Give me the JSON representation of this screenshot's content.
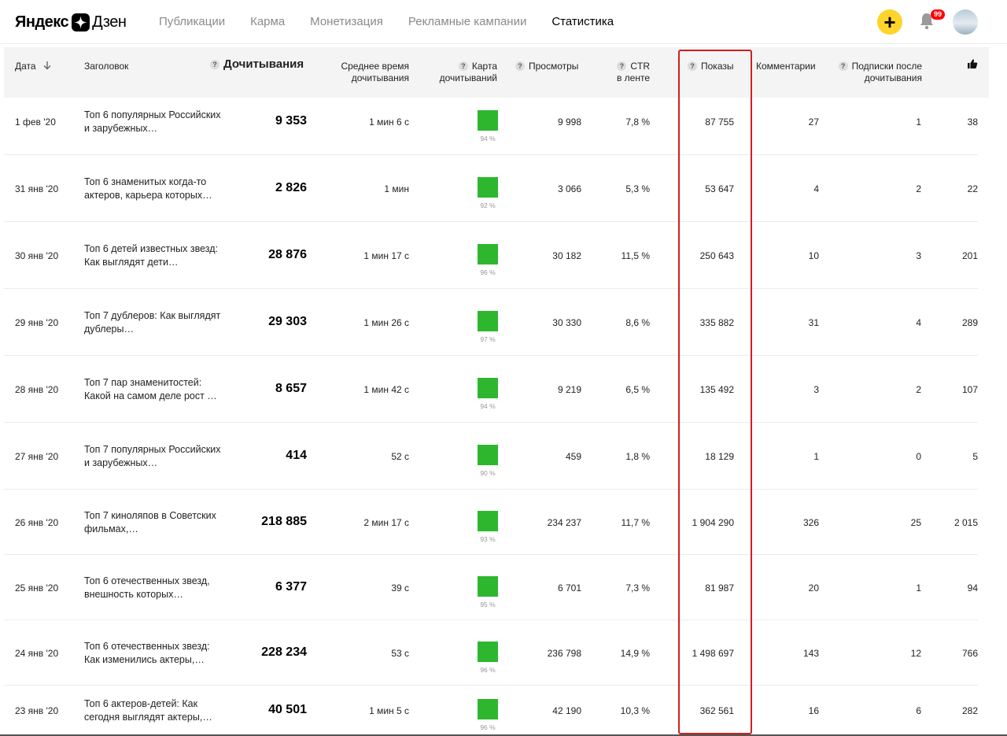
{
  "header": {
    "logo_left": "Яндекс",
    "logo_right": "Дзен",
    "nav": [
      "Публикации",
      "Карма",
      "Монетизация",
      "Рекламные кампании",
      "Статистика"
    ],
    "active_nav": 4,
    "plus_label": "+",
    "notifications_count": "99"
  },
  "table": {
    "columns": {
      "date": "Дата",
      "title": "Заголовок",
      "reads": "Дочитывания",
      "avg_time_1": "Среднее время",
      "avg_time_2": "дочитывания",
      "map_1": "Карта",
      "map_2": "дочитываний",
      "views": "Просмотры",
      "ctr_1": "CTR",
      "ctr_2": "в ленте",
      "impressions": "Показы",
      "comments": "Комментарии",
      "subs_1": "Подписки после",
      "subs_2": "дочитывания",
      "likes_icon": "thumbs-up-icon"
    },
    "rows": [
      {
        "date": "1 фев '20",
        "title": "Топ 6 популярных Российских и зарубежных…",
        "reads": "9 353",
        "avg_time": "1 мин 6 с",
        "map_pct": "94 %",
        "views": "9 998",
        "ctr": "7,8 %",
        "impressions": "87 755",
        "comments": "27",
        "subs": "1",
        "likes": "38"
      },
      {
        "date": "31 янв '20",
        "title": "Топ 6 знаменитых когда-то актеров, карьера которых…",
        "reads": "2 826",
        "avg_time": "1 мин",
        "map_pct": "92 %",
        "views": "3 066",
        "ctr": "5,3 %",
        "impressions": "53 647",
        "comments": "4",
        "subs": "2",
        "likes": "22"
      },
      {
        "date": "30 янв '20",
        "title": "Топ 6 детей известных звезд: Как выглядят дети…",
        "reads": "28 876",
        "avg_time": "1 мин 17 с",
        "map_pct": "96 %",
        "views": "30 182",
        "ctr": "11,5 %",
        "impressions": "250 643",
        "comments": "10",
        "subs": "3",
        "likes": "201"
      },
      {
        "date": "29 янв '20",
        "title": "Топ 7 дублеров: Как выглядят дублеры…",
        "reads": "29 303",
        "avg_time": "1 мин 26 с",
        "map_pct": "97 %",
        "views": "30 330",
        "ctr": "8,6 %",
        "impressions": "335 882",
        "comments": "31",
        "subs": "4",
        "likes": "289"
      },
      {
        "date": "28 янв '20",
        "title": "Топ 7 пар знаменитостей: Какой на самом деле рост …",
        "reads": "8 657",
        "avg_time": "1 мин 42 с",
        "map_pct": "94 %",
        "views": "9 219",
        "ctr": "6,5 %",
        "impressions": "135 492",
        "comments": "3",
        "subs": "2",
        "likes": "107"
      },
      {
        "date": "27 янв '20",
        "title": "Топ 7 популярных Российских и зарубежных…",
        "reads": "414",
        "avg_time": "52 с",
        "map_pct": "90 %",
        "views": "459",
        "ctr": "1,8 %",
        "impressions": "18 129",
        "comments": "1",
        "subs": "0",
        "likes": "5"
      },
      {
        "date": "26 янв '20",
        "title": "Топ 7 киноляпов в Советских фильмах,…",
        "reads": "218 885",
        "avg_time": "2 мин 17 с",
        "map_pct": "93 %",
        "views": "234 237",
        "ctr": "11,7 %",
        "impressions": "1 904 290",
        "comments": "326",
        "subs": "25",
        "likes": "2 015"
      },
      {
        "date": "25 янв '20",
        "title": "Топ 6 отечественных звезд, внешность которых…",
        "reads": "6 377",
        "avg_time": "39 с",
        "map_pct": "95 %",
        "views": "6 701",
        "ctr": "7,3 %",
        "impressions": "81 987",
        "comments": "20",
        "subs": "1",
        "likes": "94"
      },
      {
        "date": "24 янв '20",
        "title": "Топ 6 отечественных звезд: Как изменились актеры,…",
        "reads": "228 234",
        "avg_time": "53 с",
        "map_pct": "96 %",
        "views": "236 798",
        "ctr": "14,9 %",
        "impressions": "1 498 697",
        "comments": "143",
        "subs": "12",
        "likes": "766"
      },
      {
        "date": "23 янв '20",
        "title": "Топ 6 актеров-детей: Как сегодня выглядят актеры,…",
        "reads": "40 501",
        "avg_time": "1 мин 5 с",
        "map_pct": "96 %",
        "views": "42 190",
        "ctr": "10,3 %",
        "impressions": "362 561",
        "comments": "16",
        "subs": "6",
        "likes": "282"
      }
    ]
  },
  "colors": {
    "accent_yellow": "#fed42b",
    "map_green": "#2eb72e",
    "highlight_red": "#d01f1f"
  }
}
